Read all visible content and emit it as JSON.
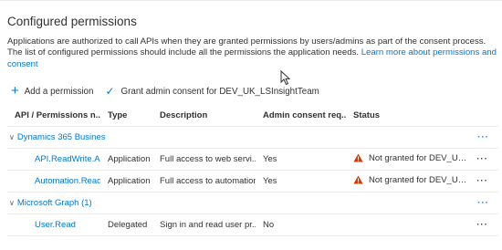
{
  "section": {
    "title": "Configured permissions",
    "description": "Applications are authorized to call APIs when they are granted permissions by users/admins as part of the consent process. The list of configured permissions should include all the permissions the application needs.",
    "learn_more": "Learn more about permissions and consent"
  },
  "toolbar": {
    "add_label": "Add a permission",
    "grant_label": "Grant admin consent for DEV_UK_LSInsightTeam"
  },
  "table": {
    "columns": [
      "API / Permissions n...",
      "Type",
      "Description",
      "Admin consent req...",
      "Status"
    ],
    "more_glyph": "···",
    "groups": [
      {
        "label": "Dynamics 365 Busines",
        "rows": [
          {
            "name": "API.ReadWrite.All",
            "type": "Application",
            "description": "Full access to web servi...",
            "admin_consent": "Yes",
            "status": "Not granted for DEV_UK_..."
          },
          {
            "name": "Automation.ReadV",
            "type": "Application",
            "description": "Full access to automation",
            "admin_consent": "Yes",
            "status": "Not granted for DEV_UK_..."
          }
        ]
      },
      {
        "label": "Microsoft Graph (1)",
        "rows": [
          {
            "name": "User.Read",
            "type": "Delegated",
            "description": "Sign in and read user pr...",
            "admin_consent": "No",
            "status": ""
          }
        ]
      }
    ]
  },
  "colors": {
    "link": "#0078d4",
    "warning": "#d83b01",
    "text": "#323130"
  },
  "icons": {
    "add": "plus-icon",
    "grant": "checkmark-icon",
    "group": "chevron-down-icon",
    "status": "warning-icon",
    "more": "more-options-icon"
  }
}
